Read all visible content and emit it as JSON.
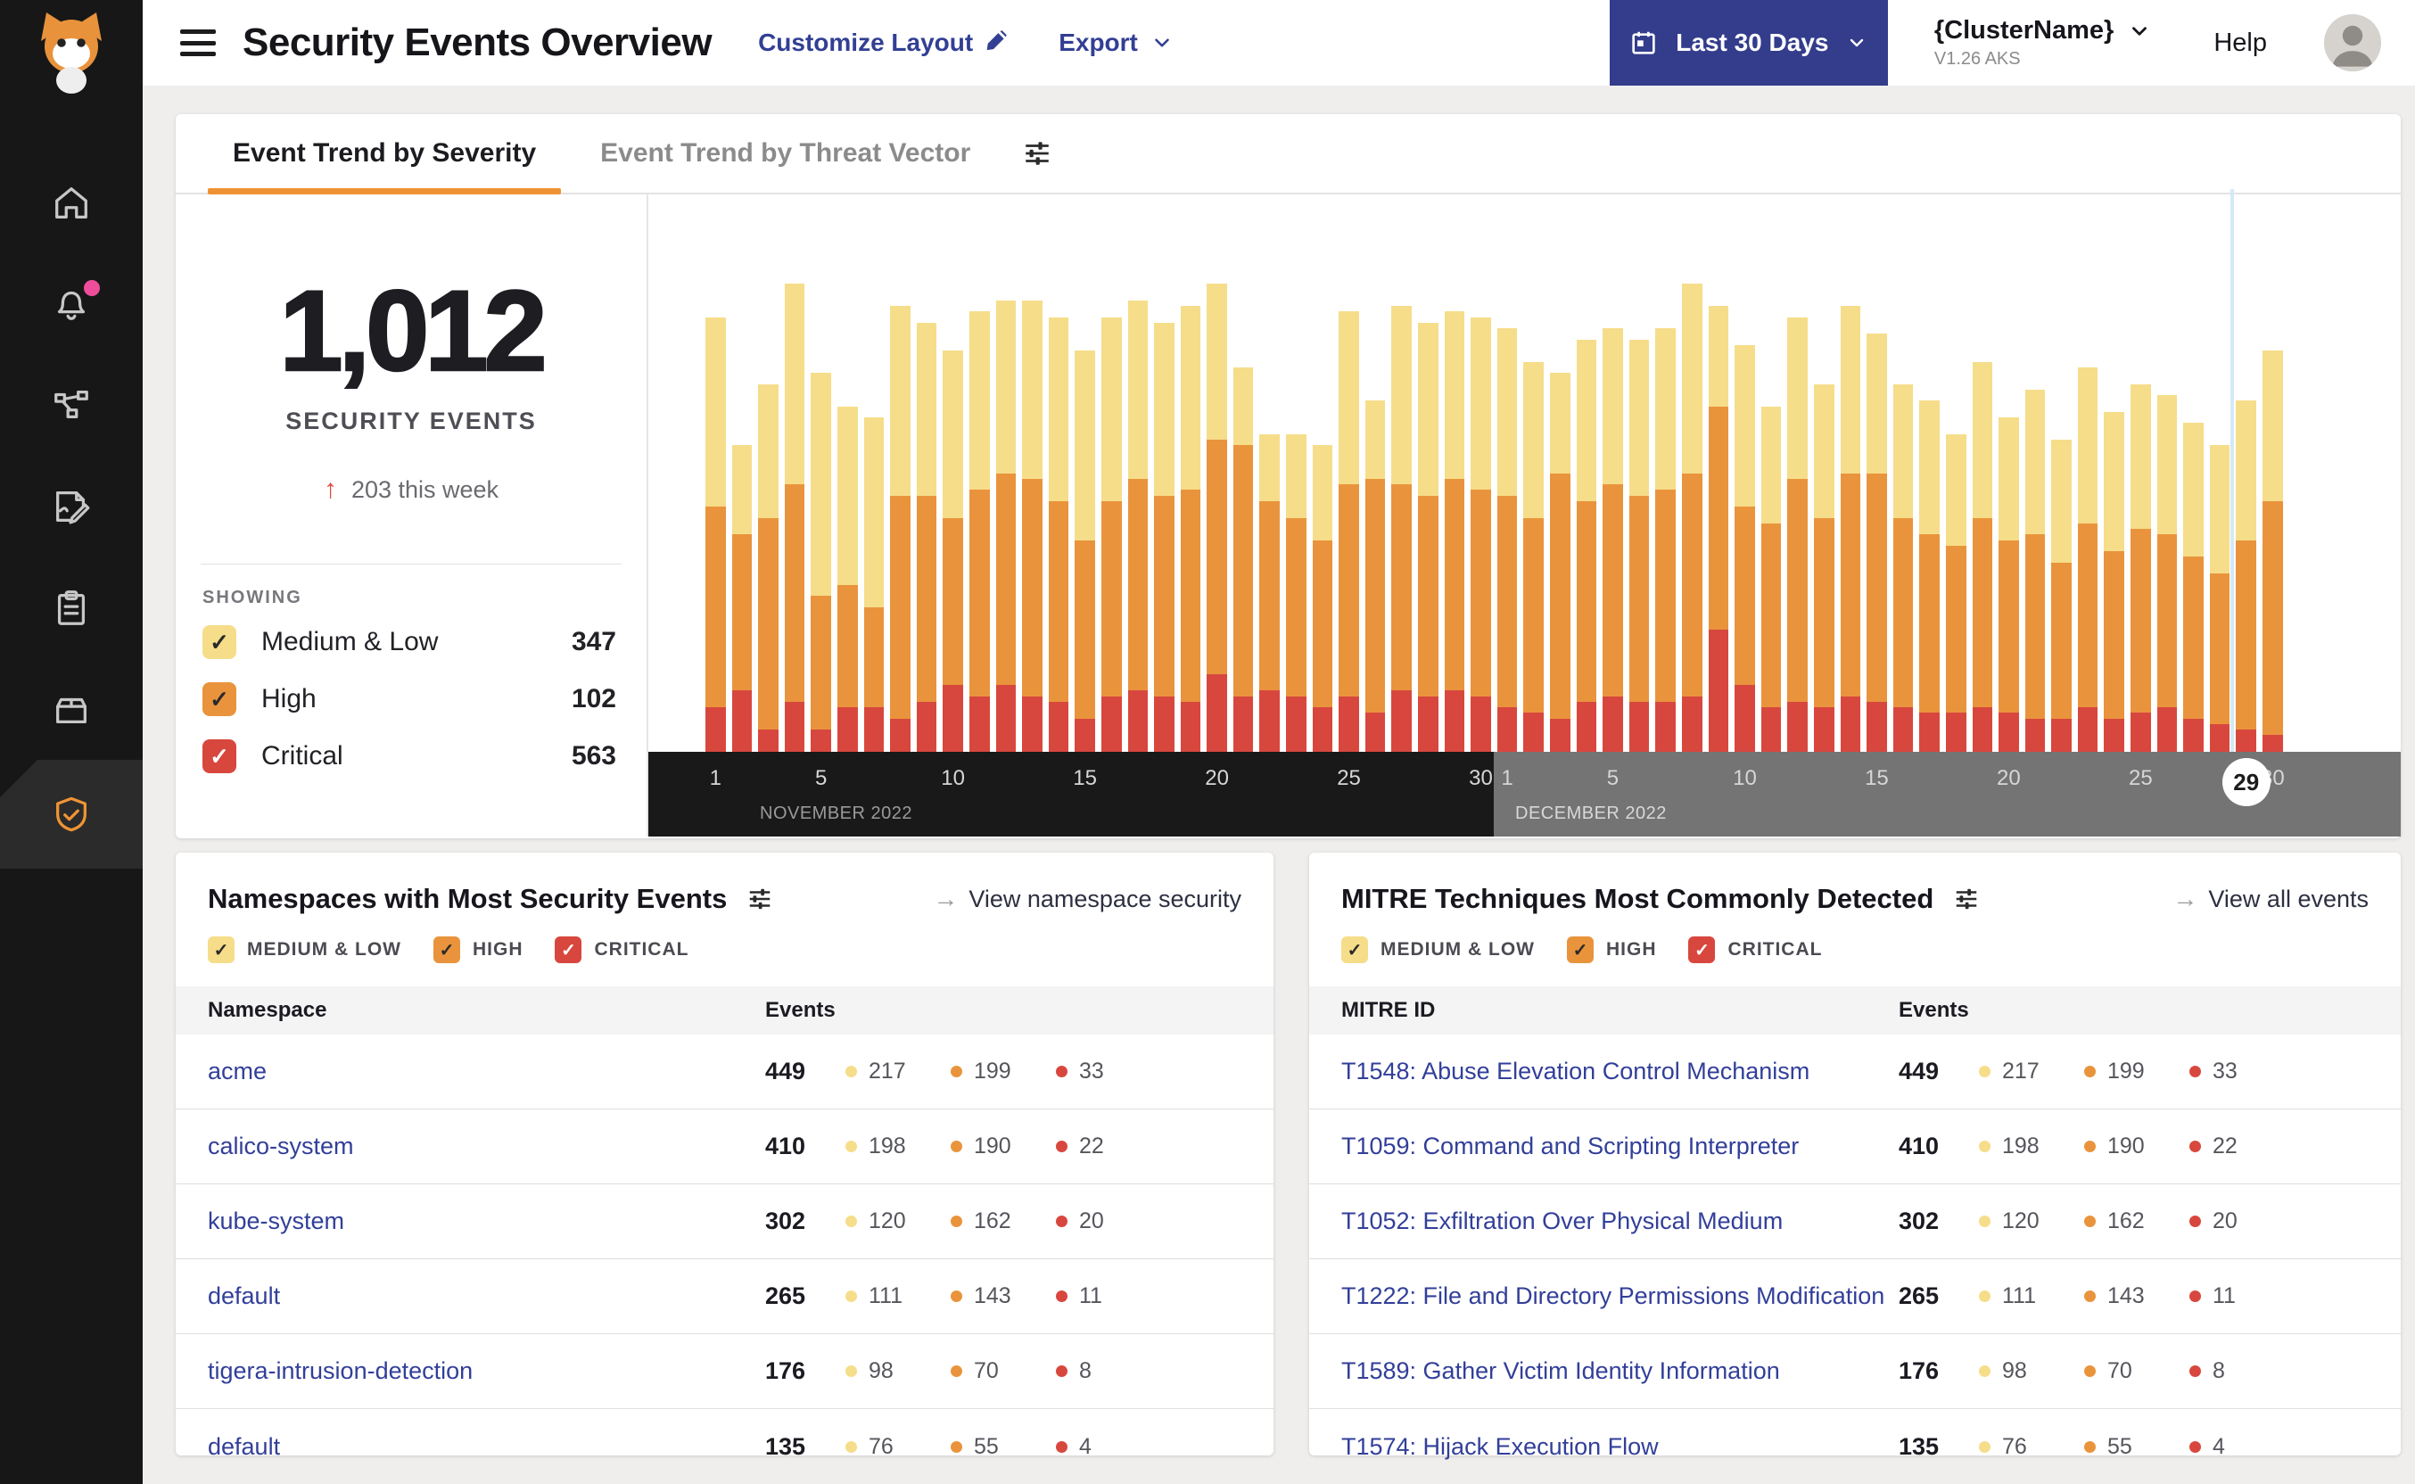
{
  "header": {
    "title": "Security Events Overview",
    "customize_label": "Customize Layout",
    "export_label": "Export",
    "date_range_label": "Last 30 Days",
    "cluster_name": "{ClusterName}",
    "cluster_version": "V1.26 AKS",
    "help_label": "Help"
  },
  "tabs": [
    {
      "label": "Event Trend by Severity",
      "active": true
    },
    {
      "label": "Event Trend by Threat Vector",
      "active": false
    }
  ],
  "stats": {
    "total": "1,012",
    "caption": "SECURITY EVENTS",
    "delta_arrow": "↑",
    "delta_text": "203 this week",
    "showing_label": "SHOWING"
  },
  "severities": [
    {
      "key": "medium_low",
      "label": "Medium & Low",
      "filter_label": "MEDIUM & LOW",
      "count": 347,
      "color": "#f6dd8a",
      "check_color": "#2a2a2a"
    },
    {
      "key": "high",
      "label": "High",
      "filter_label": "HIGH",
      "count": 102,
      "color": "#e9943c",
      "check_color": "#2a2a2a"
    },
    {
      "key": "critical",
      "label": "Critical",
      "filter_label": "CRITICAL",
      "count": 563,
      "color": "#d8473e",
      "check_color": "#ffffff"
    }
  ],
  "chart_data": {
    "type": "stacked-bar",
    "stack_order_bottom_to_top": [
      "critical",
      "high",
      "medium_low"
    ],
    "colors": {
      "medium_low": "#f6dd8a",
      "high": "#e9943c",
      "critical": "#d8473e"
    },
    "unit": "percent-of-plot-height",
    "x_axis": {
      "months": [
        {
          "label": "NOVEMBER 2022",
          "days": 30
        },
        {
          "label": "DECEMBER 2022",
          "days": 30
        }
      ],
      "ticks": [
        1,
        5,
        10,
        15,
        20,
        25,
        30
      ],
      "current": {
        "month_index": 1,
        "day": 29
      }
    },
    "values": [
      {
        "month": "Nov",
        "day": 1,
        "medium_low": 34,
        "high": 36,
        "critical": 8
      },
      {
        "month": "Nov",
        "day": 2,
        "medium_low": 16,
        "high": 28,
        "critical": 11
      },
      {
        "month": "Nov",
        "day": 3,
        "medium_low": 24,
        "high": 38,
        "critical": 4
      },
      {
        "month": "Nov",
        "day": 4,
        "medium_low": 36,
        "high": 39,
        "critical": 9
      },
      {
        "month": "Nov",
        "day": 5,
        "medium_low": 40,
        "high": 24,
        "critical": 4
      },
      {
        "month": "Nov",
        "day": 6,
        "medium_low": 32,
        "high": 22,
        "critical": 8
      },
      {
        "month": "Nov",
        "day": 7,
        "medium_low": 34,
        "high": 18,
        "critical": 8
      },
      {
        "month": "Nov",
        "day": 8,
        "medium_low": 34,
        "high": 40,
        "critical": 6
      },
      {
        "month": "Nov",
        "day": 9,
        "medium_low": 31,
        "high": 37,
        "critical": 9
      },
      {
        "month": "Nov",
        "day": 10,
        "medium_low": 30,
        "high": 30,
        "critical": 12
      },
      {
        "month": "Nov",
        "day": 11,
        "medium_low": 32,
        "high": 37,
        "critical": 10
      },
      {
        "month": "Nov",
        "day": 12,
        "medium_low": 31,
        "high": 38,
        "critical": 12
      },
      {
        "month": "Nov",
        "day": 13,
        "medium_low": 32,
        "high": 39,
        "critical": 10
      },
      {
        "month": "Nov",
        "day": 14,
        "medium_low": 33,
        "high": 36,
        "critical": 9
      },
      {
        "month": "Nov",
        "day": 15,
        "medium_low": 34,
        "high": 32,
        "critical": 6
      },
      {
        "month": "Nov",
        "day": 16,
        "medium_low": 33,
        "high": 35,
        "critical": 10
      },
      {
        "month": "Nov",
        "day": 17,
        "medium_low": 32,
        "high": 38,
        "critical": 11
      },
      {
        "month": "Nov",
        "day": 18,
        "medium_low": 31,
        "high": 36,
        "critical": 10
      },
      {
        "month": "Nov",
        "day": 19,
        "medium_low": 33,
        "high": 38,
        "critical": 9
      },
      {
        "month": "Nov",
        "day": 20,
        "medium_low": 28,
        "high": 42,
        "critical": 14
      },
      {
        "month": "Nov",
        "day": 21,
        "medium_low": 14,
        "high": 45,
        "critical": 10
      },
      {
        "month": "Nov",
        "day": 22,
        "medium_low": 12,
        "high": 34,
        "critical": 11
      },
      {
        "month": "Nov",
        "day": 23,
        "medium_low": 15,
        "high": 32,
        "critical": 10
      },
      {
        "month": "Nov",
        "day": 24,
        "medium_low": 17,
        "high": 30,
        "critical": 8
      },
      {
        "month": "Nov",
        "day": 25,
        "medium_low": 31,
        "high": 38,
        "critical": 10
      },
      {
        "month": "Nov",
        "day": 26,
        "medium_low": 14,
        "high": 42,
        "critical": 7
      },
      {
        "month": "Nov",
        "day": 27,
        "medium_low": 32,
        "high": 37,
        "critical": 11
      },
      {
        "month": "Nov",
        "day": 28,
        "medium_low": 31,
        "high": 36,
        "critical": 10
      },
      {
        "month": "Nov",
        "day": 29,
        "medium_low": 30,
        "high": 38,
        "critical": 11
      },
      {
        "month": "Nov",
        "day": 30,
        "medium_low": 31,
        "high": 37,
        "critical": 10
      },
      {
        "month": "Dec",
        "day": 1,
        "medium_low": 30,
        "high": 38,
        "critical": 8
      },
      {
        "month": "Dec",
        "day": 2,
        "medium_low": 28,
        "high": 35,
        "critical": 7
      },
      {
        "month": "Dec",
        "day": 3,
        "medium_low": 18,
        "high": 44,
        "critical": 6
      },
      {
        "month": "Dec",
        "day": 4,
        "medium_low": 29,
        "high": 36,
        "critical": 9
      },
      {
        "month": "Dec",
        "day": 5,
        "medium_low": 28,
        "high": 38,
        "critical": 10
      },
      {
        "month": "Dec",
        "day": 6,
        "medium_low": 28,
        "high": 37,
        "critical": 9
      },
      {
        "month": "Dec",
        "day": 7,
        "medium_low": 29,
        "high": 38,
        "critical": 9
      },
      {
        "month": "Dec",
        "day": 8,
        "medium_low": 34,
        "high": 40,
        "critical": 10
      },
      {
        "month": "Dec",
        "day": 9,
        "medium_low": 18,
        "high": 40,
        "critical": 22
      },
      {
        "month": "Dec",
        "day": 10,
        "medium_low": 29,
        "high": 32,
        "critical": 12
      },
      {
        "month": "Dec",
        "day": 11,
        "medium_low": 21,
        "high": 33,
        "critical": 8
      },
      {
        "month": "Dec",
        "day": 12,
        "medium_low": 29,
        "high": 40,
        "critical": 9
      },
      {
        "month": "Dec",
        "day": 13,
        "medium_low": 24,
        "high": 34,
        "critical": 8
      },
      {
        "month": "Dec",
        "day": 14,
        "medium_low": 30,
        "high": 40,
        "critical": 10
      },
      {
        "month": "Dec",
        "day": 15,
        "medium_low": 25,
        "high": 41,
        "critical": 9
      },
      {
        "month": "Dec",
        "day": 16,
        "medium_low": 24,
        "high": 34,
        "critical": 8
      },
      {
        "month": "Dec",
        "day": 17,
        "medium_low": 24,
        "high": 32,
        "critical": 7
      },
      {
        "month": "Dec",
        "day": 18,
        "medium_low": 20,
        "high": 30,
        "critical": 7
      },
      {
        "month": "Dec",
        "day": 19,
        "medium_low": 28,
        "high": 34,
        "critical": 8
      },
      {
        "month": "Dec",
        "day": 20,
        "medium_low": 22,
        "high": 31,
        "critical": 7
      },
      {
        "month": "Dec",
        "day": 21,
        "medium_low": 26,
        "high": 33,
        "critical": 6
      },
      {
        "month": "Dec",
        "day": 22,
        "medium_low": 22,
        "high": 28,
        "critical": 6
      },
      {
        "month": "Dec",
        "day": 23,
        "medium_low": 28,
        "high": 33,
        "critical": 8
      },
      {
        "month": "Dec",
        "day": 24,
        "medium_low": 25,
        "high": 30,
        "critical": 6
      },
      {
        "month": "Dec",
        "day": 25,
        "medium_low": 26,
        "high": 33,
        "critical": 7
      },
      {
        "month": "Dec",
        "day": 26,
        "medium_low": 25,
        "high": 31,
        "critical": 8
      },
      {
        "month": "Dec",
        "day": 27,
        "medium_low": 24,
        "high": 29,
        "critical": 6
      },
      {
        "month": "Dec",
        "day": 28,
        "medium_low": 23,
        "high": 27,
        "critical": 5
      },
      {
        "month": "Dec",
        "day": 29,
        "medium_low": 25,
        "high": 34,
        "critical": 4
      },
      {
        "month": "Dec",
        "day": 30,
        "medium_low": 27,
        "high": 42,
        "critical": 3
      }
    ]
  },
  "namespaces_card": {
    "title": "Namespaces with Most Security Events",
    "link_label": "View namespace security",
    "columns": [
      "Namespace",
      "Events"
    ],
    "rows": [
      {
        "name": "acme",
        "total": 449,
        "medium_low": 217,
        "high": 199,
        "critical": 33
      },
      {
        "name": "calico-system",
        "total": 410,
        "medium_low": 198,
        "high": 190,
        "critical": 22
      },
      {
        "name": "kube-system",
        "total": 302,
        "medium_low": 120,
        "high": 162,
        "critical": 20
      },
      {
        "name": "default",
        "total": 265,
        "medium_low": 111,
        "high": 143,
        "critical": 11
      },
      {
        "name": "tigera-intrusion-detection",
        "total": 176,
        "medium_low": 98,
        "high": 70,
        "critical": 8
      },
      {
        "name": "default",
        "total": 135,
        "medium_low": 76,
        "high": 55,
        "critical": 4
      }
    ]
  },
  "mitre_card": {
    "title": "MITRE Techniques Most Commonly Detected",
    "link_label": "View all events",
    "columns": [
      "MITRE ID",
      "Events"
    ],
    "rows": [
      {
        "name": "T1548: Abuse Elevation Control Mechanism",
        "total": 449,
        "medium_low": 217,
        "high": 199,
        "critical": 33
      },
      {
        "name": "T1059: Command and Scripting Interpreter",
        "total": 410,
        "medium_low": 198,
        "high": 190,
        "critical": 22
      },
      {
        "name": "T1052: Exfiltration Over Physical Medium",
        "total": 302,
        "medium_low": 120,
        "high": 162,
        "critical": 20
      },
      {
        "name": "T1222: File and Directory Permissions Modification",
        "total": 265,
        "medium_low": 111,
        "high": 143,
        "critical": 11
      },
      {
        "name": "T1589: Gather Victim Identity Information",
        "total": 176,
        "medium_low": 98,
        "high": 70,
        "critical": 8
      },
      {
        "name": "T1574: Hijack Execution Flow",
        "total": 135,
        "medium_low": 76,
        "high": 55,
        "critical": 4
      }
    ]
  }
}
